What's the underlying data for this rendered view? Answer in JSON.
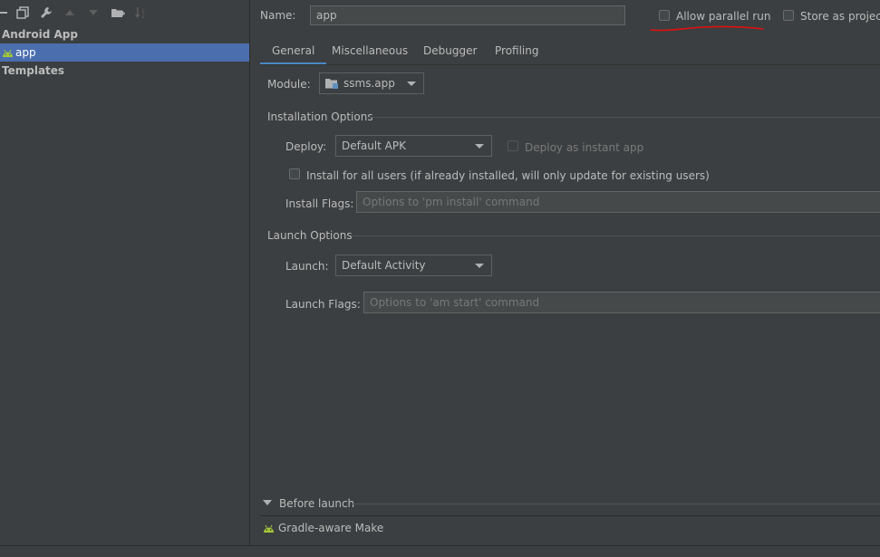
{
  "toolbar": {
    "icons": [
      "minus-icon",
      "copy-icon",
      "wrench-icon",
      "arrow-up-icon",
      "arrow-down-icon",
      "folder-add-icon",
      "sort-icon"
    ]
  },
  "tree": {
    "group_android": "Android App",
    "item_app": "app",
    "group_templates": "Templates"
  },
  "header": {
    "name_label": "Name:",
    "name_value": "app",
    "allow_parallel": "Allow parallel run",
    "store_as_project": "Store as project"
  },
  "tabs": [
    "General",
    "Miscellaneous",
    "Debugger",
    "Profiling"
  ],
  "module": {
    "label": "Module:",
    "value": "ssms.app"
  },
  "installation": {
    "title": "Installation Options",
    "deploy_label": "Deploy:",
    "deploy_value": "Default APK",
    "instant_app": "Deploy as instant app",
    "install_all_users": "Install for all users (if already installed, will only update for existing users)",
    "flags_label": "Install Flags:",
    "flags_placeholder": "Options to 'pm install' command"
  },
  "launch": {
    "title": "Launch Options",
    "launch_label": "Launch:",
    "launch_value": "Default Activity",
    "flags_label": "Launch Flags:",
    "flags_placeholder": "Options to 'am start' command"
  },
  "before_launch": {
    "title": "Before launch",
    "task": "Gradle-aware Make"
  },
  "colors": {
    "background": "#3c3f41",
    "selection": "#4b6eaf",
    "accent_tab": "#4a88c7",
    "android_green": "#a4c639",
    "annotation_red": "#e01010"
  }
}
